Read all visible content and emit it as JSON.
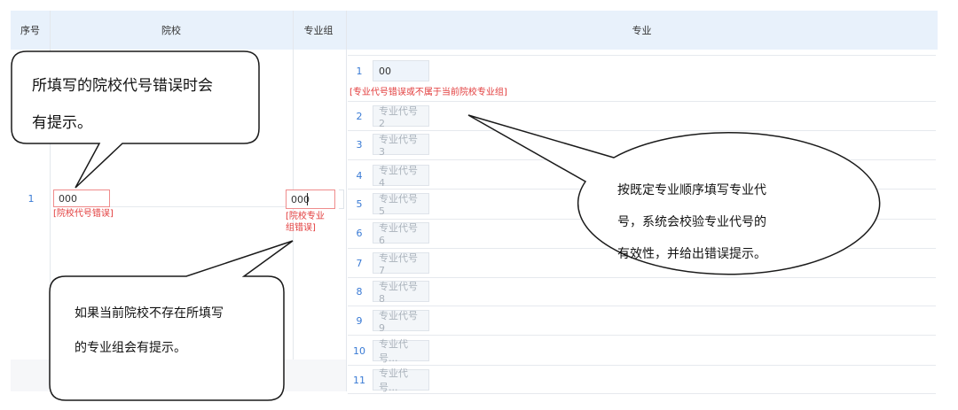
{
  "table": {
    "headers": {
      "index": "序号",
      "school": "院校",
      "group": "专业组",
      "major": "专业"
    },
    "row": {
      "index": "1",
      "school_value": "000",
      "school_error": "[院校代号错误]",
      "group_value": "000",
      "group_error_line1": "[院校专业",
      "group_error_line2": "组错误]"
    }
  },
  "majors": [
    {
      "num": "1",
      "value": "00",
      "error": "[专业代号错误或不属于当前院校专业组]"
    },
    {
      "num": "2",
      "placeholder": "专业代号2"
    },
    {
      "num": "3",
      "placeholder": "专业代号3"
    },
    {
      "num": "4",
      "placeholder": "专业代号4"
    },
    {
      "num": "5",
      "placeholder": "专业代号5"
    },
    {
      "num": "6",
      "placeholder": "专业代号6"
    },
    {
      "num": "7",
      "placeholder": "专业代号7"
    },
    {
      "num": "8",
      "placeholder": "专业代号8"
    },
    {
      "num": "9",
      "placeholder": "专业代号9"
    },
    {
      "num": "10",
      "placeholder": "专业代号..."
    },
    {
      "num": "11",
      "placeholder": "专业代号..."
    }
  ],
  "callouts": {
    "school": {
      "line1": "所填写的院校代号错误时会",
      "line2": "有提示。"
    },
    "group": {
      "line1": "如果当前院校不存在所填写",
      "line2": "的专业组会有提示。"
    },
    "major": {
      "line1": "按既定专业顺序填写专业代",
      "line2": "号，系统会校验专业代号的",
      "line3": "有效性，并给出错误提示。"
    }
  }
}
